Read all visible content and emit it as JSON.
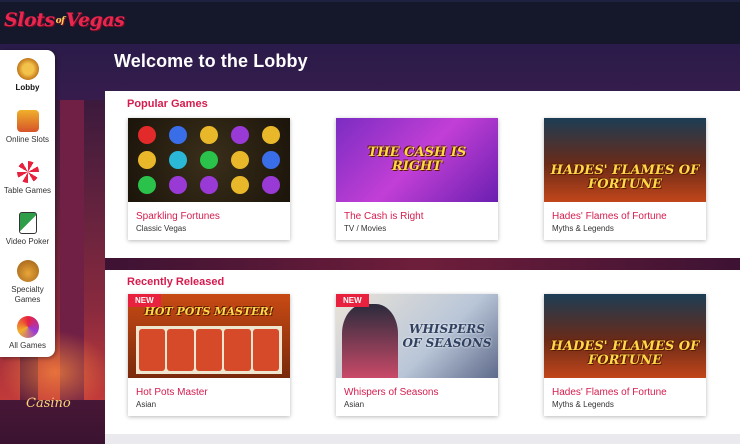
{
  "header": {
    "logo_main": "Slots",
    "logo_of": "of",
    "logo_tail": "Vegas"
  },
  "sidebar": {
    "items": [
      {
        "label": "Lobby",
        "icon": "lobby-icon",
        "active": true
      },
      {
        "label": "Online Slots",
        "icon": "slot-machine-icon"
      },
      {
        "label": "Table Games",
        "icon": "roulette-icon"
      },
      {
        "label": "Video Poker",
        "icon": "playing-cards-icon"
      },
      {
        "label": "Specialty Games",
        "icon": "specialty-bowl-icon"
      },
      {
        "label": "All Games",
        "icon": "all-games-icon"
      }
    ]
  },
  "page": {
    "title": "Welcome to the Lobby"
  },
  "popular": {
    "title": "Popular Games",
    "games": [
      {
        "name": "Sparkling Fortunes",
        "category": "Classic Vegas"
      },
      {
        "name": "The Cash is Right",
        "category": "TV / Movies",
        "thumb_text": "THE CASH IS RIGHT"
      },
      {
        "name": "Hades' Flames of Fortune",
        "category": "Myths & Legends",
        "thumb_text": "HADES' FLAMES OF FORTUNE"
      }
    ]
  },
  "recent": {
    "title": "Recently Released",
    "badge": "NEW",
    "games": [
      {
        "name": "Hot Pots Master",
        "category": "Asian",
        "is_new": true,
        "thumb_text": "HOT POTS MASTER!"
      },
      {
        "name": "Whispers of Seasons",
        "category": "Asian",
        "is_new": true,
        "thumb_text": "WHISPERS OF SEASONS"
      },
      {
        "name": "Hades' Flames of Fortune",
        "category": "Myths & Legends",
        "thumb_text": "HADES' FLAMES OF FORTUNE"
      }
    ]
  },
  "background": {
    "sign": "Casino"
  },
  "colors": {
    "accent": "#d61c4e",
    "badge": "#e8213e",
    "topbar": "#15172b"
  }
}
